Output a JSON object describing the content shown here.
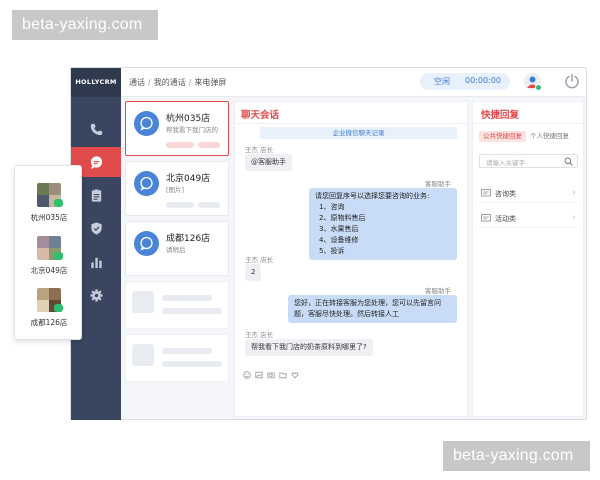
{
  "watermark": {
    "text_top": "beta-yaxing.com",
    "text_bottom": "beta-yaxing.com"
  },
  "app": {
    "logo": "HOLLYCRM",
    "breadcrumb": [
      "通话",
      "我的通话",
      "来电弹屏"
    ],
    "status": {
      "label": "空闲",
      "timer": "00:00:00"
    }
  },
  "sidebar": {
    "items": [
      {
        "icon": "phone-icon",
        "active": false
      },
      {
        "icon": "chat-bubble-icon",
        "active": true
      },
      {
        "icon": "clipboard-icon",
        "active": false
      },
      {
        "icon": "shield-icon",
        "active": false
      },
      {
        "icon": "bar-chart-icon",
        "active": false
      },
      {
        "icon": "gear-icon",
        "active": false
      }
    ]
  },
  "conversations": [
    {
      "name": "杭州035店",
      "preview": "帮我看下我门店的",
      "active": true
    },
    {
      "name": "北京049店",
      "preview": "[图片]",
      "active": false
    },
    {
      "name": "成都126店",
      "preview": "请稍后",
      "active": false
    }
  ],
  "chat": {
    "title": "聊天会话",
    "record_label": "企业微信聊天记录",
    "messages": [
      {
        "side": "left",
        "sender": "王杰 店长",
        "text": "@客服助手"
      },
      {
        "side": "right",
        "sender": "客服助手",
        "intro": "请您回复序号以选择您要咨询的业务:",
        "options": [
          "1、咨询",
          "2、原物料售后",
          "3、水果售后",
          "4、设备维修",
          "5、投诉"
        ]
      },
      {
        "side": "left",
        "sender": "王杰 店长",
        "text": "2"
      },
      {
        "side": "right",
        "sender": "客服助手",
        "text": "您好，正在转接客服为您处理，您可以先留言问题，客服尽快处理。然后转接人工"
      },
      {
        "side": "left",
        "sender": "王杰 店长",
        "text": "帮我看下我门店的奶茶原料到哪里了?"
      }
    ],
    "tools": [
      "emoji-icon",
      "image-icon",
      "camera-icon",
      "folder-icon",
      "heart-icon"
    ]
  },
  "quick_reply": {
    "title": "快捷回复",
    "tabs": [
      "公共快捷回复",
      "个人快捷回复"
    ],
    "search_placeholder": "请输入关键字",
    "categories": [
      "咨询类",
      "活动类"
    ]
  },
  "float_card": {
    "stores": [
      "杭州035店",
      "北京049店",
      "成都126店"
    ]
  },
  "colors": {
    "accent": "#e14b4b",
    "sidebar": "#3a4560",
    "brand_blue": "#4a84d8",
    "bubble_right": "#c9dcf7"
  }
}
